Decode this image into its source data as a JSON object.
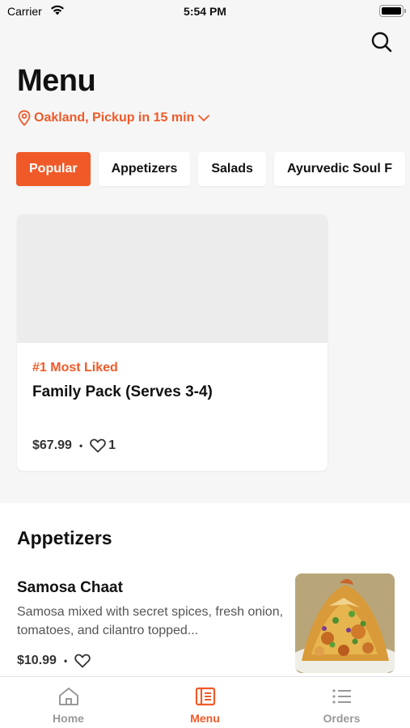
{
  "status_bar": {
    "carrier": "Carrier",
    "time": "5:54 PM"
  },
  "header": {
    "title": "Menu",
    "location_text": "Oakland, Pickup in 15 min"
  },
  "categories": [
    {
      "label": "Popular",
      "active": true
    },
    {
      "label": "Appetizers",
      "active": false
    },
    {
      "label": "Salads",
      "active": false
    },
    {
      "label": "Ayurvedic Soul F",
      "active": false
    }
  ],
  "featured": {
    "badge": "#1 Most Liked",
    "name": "Family Pack (Serves 3-4)",
    "price": "$67.99",
    "dot": "•",
    "likes": "1"
  },
  "section": {
    "title": "Appetizers",
    "items": [
      {
        "name": "Samosa Chaat",
        "description": "Samosa mixed with secret spices, fresh onion, tomatoes, and cilantro topped...",
        "price": "$10.99",
        "dot": "•"
      }
    ]
  },
  "tab_bar": [
    {
      "label": "Home",
      "icon": "home-icon",
      "active": false
    },
    {
      "label": "Menu",
      "icon": "menu-book-icon",
      "active": true
    },
    {
      "label": "Orders",
      "icon": "list-icon",
      "active": false
    }
  ],
  "colors": {
    "accent": "#f05a28",
    "background": "#f6f6f6",
    "inactive": "#999999"
  }
}
